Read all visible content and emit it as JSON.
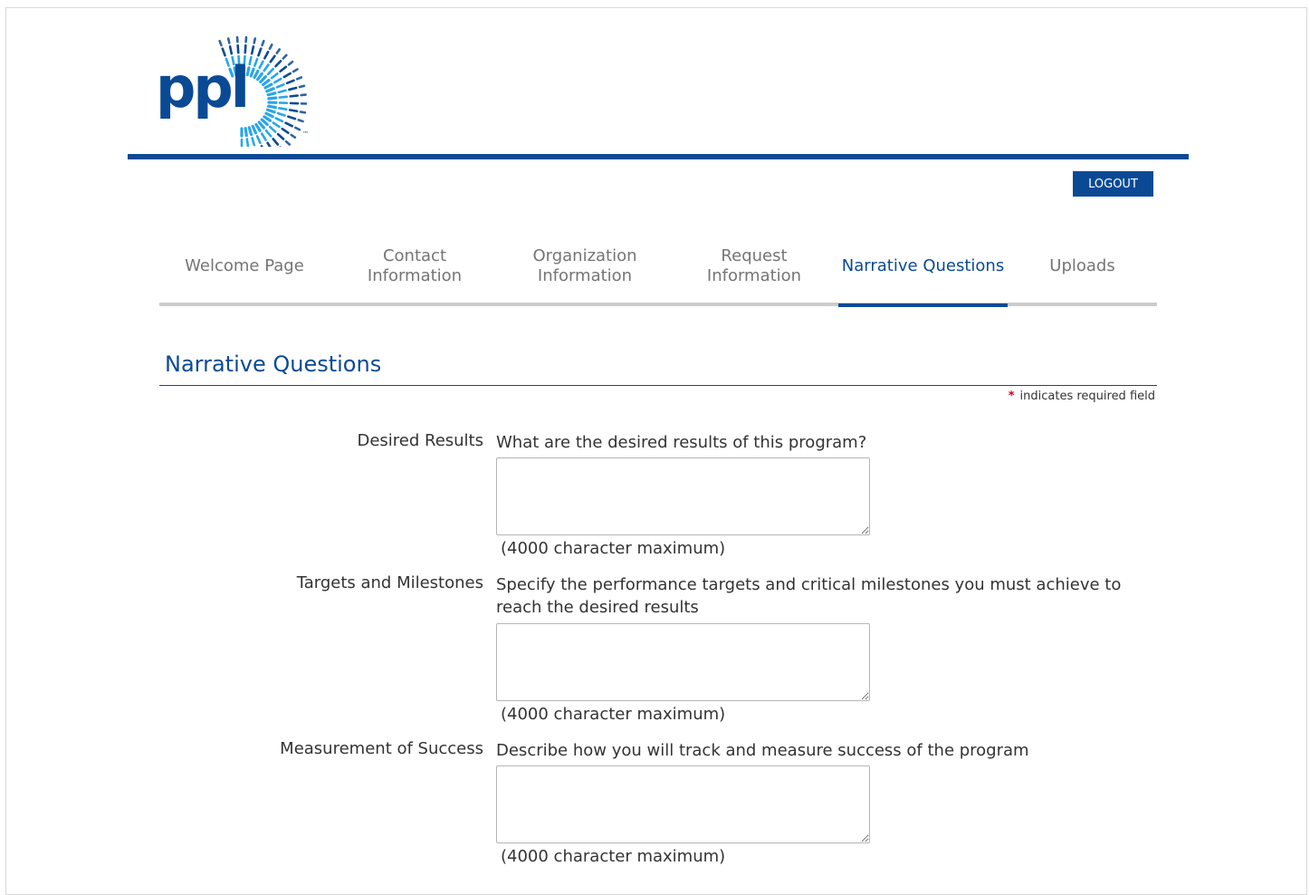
{
  "brand": {
    "logo_text": "ppl",
    "logo_tm": "™",
    "primary_color": "#0a4a95",
    "light_color": "#29a6e8"
  },
  "header": {
    "logout_label": "LOGOUT"
  },
  "tabs": [
    {
      "label_line1": "Welcome Page",
      "label_line2": "",
      "active": false
    },
    {
      "label_line1": "Contact",
      "label_line2": "Information",
      "active": false
    },
    {
      "label_line1": "Organization",
      "label_line2": "Information",
      "active": false
    },
    {
      "label_line1": "Request",
      "label_line2": "Information",
      "active": false
    },
    {
      "label_line1": "Narrative Questions",
      "label_line2": "",
      "active": true
    },
    {
      "label_line1": "Uploads",
      "label_line2": "",
      "active": false
    }
  ],
  "section": {
    "title": "Narrative Questions",
    "required_star": "*",
    "required_note": "indicates required field"
  },
  "fields": [
    {
      "label": "Desired Results",
      "question": "What are the desired results of this program?",
      "value": "",
      "hint": "(4000 character maximum)"
    },
    {
      "label": "Targets and Milestones",
      "question": "Specify the performance targets and critical milestones you must achieve to reach the desired results",
      "value": "",
      "hint": "(4000 character maximum)"
    },
    {
      "label": "Measurement of Success",
      "question": "Describe how you will track and measure success of the program",
      "value": "",
      "hint": "(4000 character maximum)"
    }
  ],
  "colors": {
    "required_star": "#d0021b",
    "inactive_tab": "#757575",
    "tab_rule": "#cccccc"
  }
}
